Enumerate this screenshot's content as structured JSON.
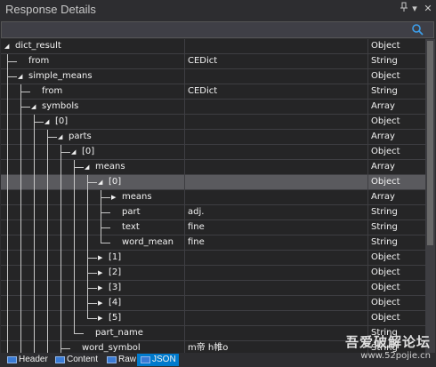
{
  "window": {
    "title": "Response Details"
  },
  "search": {
    "placeholder": "",
    "value": ""
  },
  "rows": [
    {
      "name": "dict_result",
      "value": "",
      "type": "Object",
      "depth": 0,
      "expander": "open"
    },
    {
      "name": "from",
      "value": "CEDict",
      "type": "String",
      "depth": 1,
      "expander": "none"
    },
    {
      "name": "simple_means",
      "value": "",
      "type": "Object",
      "depth": 1,
      "expander": "open"
    },
    {
      "name": "from",
      "value": "CEDict",
      "type": "String",
      "depth": 2,
      "expander": "none"
    },
    {
      "name": "symbols",
      "value": "",
      "type": "Array",
      "depth": 2,
      "expander": "open"
    },
    {
      "name": "[0]",
      "value": "",
      "type": "Object",
      "depth": 3,
      "expander": "open"
    },
    {
      "name": "parts",
      "value": "",
      "type": "Array",
      "depth": 4,
      "expander": "open"
    },
    {
      "name": "[0]",
      "value": "",
      "type": "Object",
      "depth": 5,
      "expander": "open"
    },
    {
      "name": "means",
      "value": "",
      "type": "Array",
      "depth": 6,
      "expander": "open"
    },
    {
      "name": "[0]",
      "value": "",
      "type": "Object",
      "depth": 7,
      "expander": "open",
      "selected": true
    },
    {
      "name": "means",
      "value": "",
      "type": "Array",
      "depth": 8,
      "expander": "closed"
    },
    {
      "name": "part",
      "value": "adj.",
      "type": "String",
      "depth": 8,
      "expander": "none"
    },
    {
      "name": "text",
      "value": "fine",
      "type": "String",
      "depth": 8,
      "expander": "none"
    },
    {
      "name": "word_mean",
      "value": "fine",
      "type": "String",
      "depth": 8,
      "expander": "none"
    },
    {
      "name": "[1]",
      "value": "",
      "type": "Object",
      "depth": 7,
      "expander": "closed"
    },
    {
      "name": "[2]",
      "value": "",
      "type": "Object",
      "depth": 7,
      "expander": "closed"
    },
    {
      "name": "[3]",
      "value": "",
      "type": "Object",
      "depth": 7,
      "expander": "closed"
    },
    {
      "name": "[4]",
      "value": "",
      "type": "Object",
      "depth": 7,
      "expander": "closed"
    },
    {
      "name": "[5]",
      "value": "",
      "type": "Object",
      "depth": 7,
      "expander": "closed"
    },
    {
      "name": "part_name",
      "value": "",
      "type": "String",
      "depth": 6,
      "expander": "none"
    },
    {
      "name": "word_symbol",
      "value": "m帝 h帷o",
      "type": "String",
      "depth": 5,
      "expander": "none"
    }
  ],
  "tabs": [
    {
      "label": "Header",
      "icon": "header-icon",
      "active": false
    },
    {
      "label": "Content",
      "icon": "content-icon",
      "active": false
    },
    {
      "label": "Raw",
      "icon": "raw-icon",
      "active": false
    },
    {
      "label": "JSON",
      "icon": "json-icon",
      "active": true
    }
  ],
  "watermark": {
    "line1": "吾爱破解论坛",
    "line2": "www.52pojie.cn"
  },
  "colors": {
    "accent": "#007acc",
    "background": "#252526",
    "selected": "#5a5a5e",
    "grid_line": "#3e3e42"
  }
}
